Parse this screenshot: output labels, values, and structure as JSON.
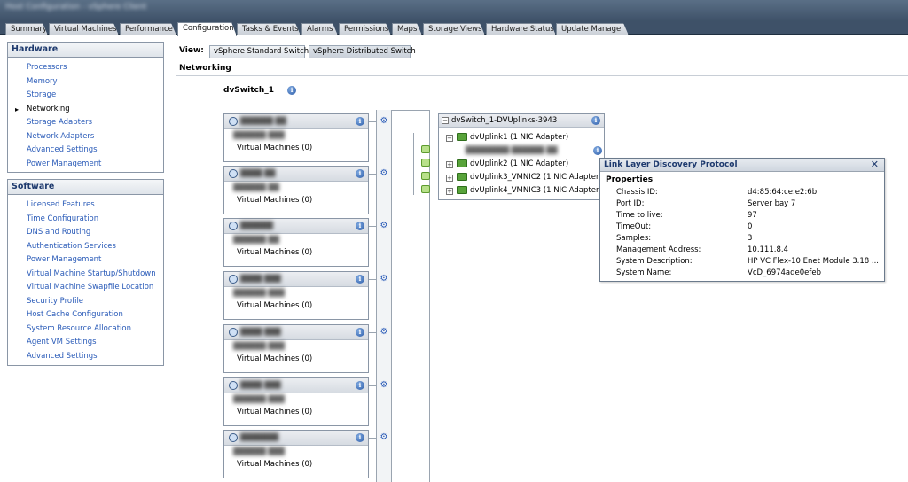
{
  "window": {
    "title": "Host Configuration - vSphere Client"
  },
  "tabs": [
    {
      "label": "Summary",
      "active": false
    },
    {
      "label": "Virtual Machines",
      "active": false
    },
    {
      "label": "Performance",
      "active": false
    },
    {
      "label": "Configuration",
      "active": true
    },
    {
      "label": "Tasks & Events",
      "active": false
    },
    {
      "label": "Alarms",
      "active": false
    },
    {
      "label": "Permissions",
      "active": false
    },
    {
      "label": "Maps",
      "active": false
    },
    {
      "label": "Storage Views",
      "active": false
    },
    {
      "label": "Hardware Status",
      "active": false
    },
    {
      "label": "Update Manager",
      "active": false
    }
  ],
  "hardware": {
    "title": "Hardware",
    "items": [
      "Processors",
      "Memory",
      "Storage",
      "Networking",
      "Storage Adapters",
      "Network Adapters",
      "Advanced Settings",
      "Power Management"
    ],
    "current": "Networking"
  },
  "software": {
    "title": "Software",
    "items": [
      "Licensed Features",
      "Time Configuration",
      "DNS and Routing",
      "Authentication Services",
      "Power Management",
      "Virtual Machine Startup/Shutdown",
      "Virtual Machine Swapfile Location",
      "Security Profile",
      "Host Cache Configuration",
      "System Resource Allocation",
      "Agent VM Settings",
      "Advanced Settings"
    ]
  },
  "view": {
    "label": "View:",
    "standard": "vSphere Standard Switch",
    "distributed": "vSphere Distributed Switch"
  },
  "section_title": "Networking",
  "dvswitch_name": "dvSwitch_1",
  "port_groups": [
    {
      "vms": "Virtual Machines (0)"
    },
    {
      "vms": "Virtual Machines (0)"
    },
    {
      "vms": "Virtual Machines (0)"
    },
    {
      "vms": "Virtual Machines (0)"
    },
    {
      "vms": "Virtual Machines (0)"
    },
    {
      "vms": "Virtual Machines (0)"
    },
    {
      "vms": "Virtual Machines (0)"
    }
  ],
  "uplinks": {
    "title": "dvSwitch_1-DVUplinks-3943",
    "items": [
      "dvUplink1 (1 NIC Adapter)",
      "dvUplink2 (1 NIC Adapter)",
      "dvUplink3_VMNIC2 (1 NIC Adapter)",
      "dvUplink4_VMNIC3 (1 NIC Adapter)"
    ]
  },
  "lldp": {
    "title": "Link Layer Discovery Protocol",
    "close": "✕",
    "properties_label": "Properties",
    "rows": [
      {
        "key": "Chassis ID:",
        "value": "d4:85:64:ce:e2:6b"
      },
      {
        "key": "Port ID:",
        "value": "Server bay 7"
      },
      {
        "key": "Time to live:",
        "value": "97"
      },
      {
        "key": "TimeOut:",
        "value": "0"
      },
      {
        "key": "Samples:",
        "value": "3"
      },
      {
        "key": "Management Address:",
        "value": "10.111.8.4"
      },
      {
        "key": "System Description:",
        "value": "HP VC Flex-10 Enet Module 3.18 ..."
      },
      {
        "key": "System Name:",
        "value": "VcD_6974ade0efeb"
      }
    ]
  }
}
